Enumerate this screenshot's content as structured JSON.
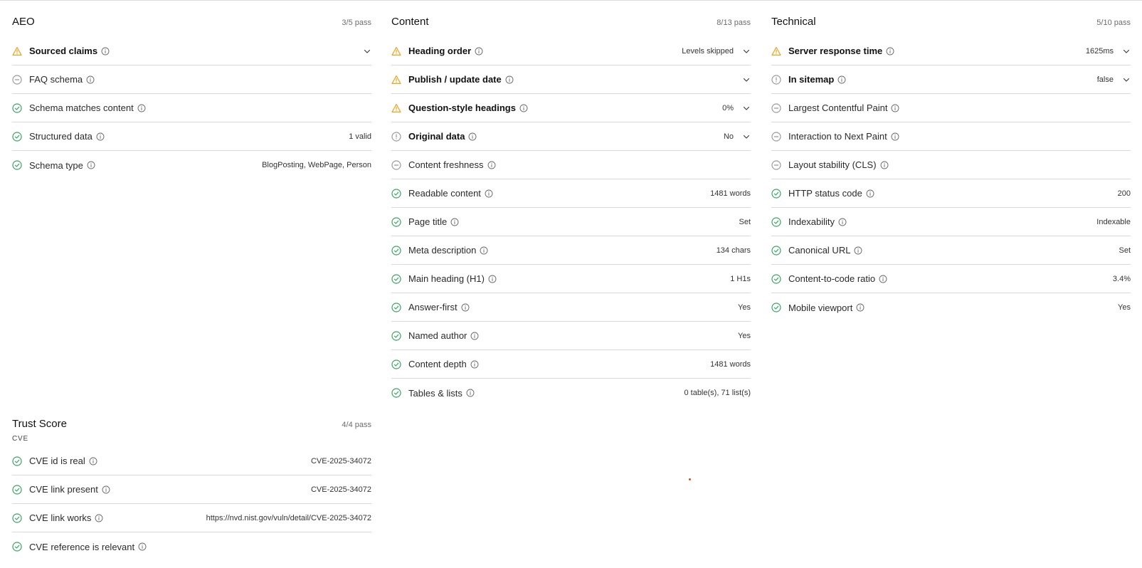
{
  "colors": {
    "pass": "#3aa463",
    "warn": "#e8a423",
    "neutral": "#9a9a9a",
    "divider": "#d9d9d9"
  },
  "icons": {
    "pass": "check-circle-icon",
    "warn": "warning-triangle-icon",
    "skip": "minus-circle-icon",
    "alert": "exclamation-circle-icon",
    "info": "info-icon",
    "expand": "chevron-down-icon"
  },
  "aeo": {
    "title": "AEO",
    "count": "3/5 pass",
    "rows": [
      {
        "label": "Sourced claims",
        "value": "",
        "status": "warn",
        "expandable": true
      },
      {
        "label": "FAQ schema",
        "value": "",
        "status": "skip",
        "expandable": false
      },
      {
        "label": "Schema matches content",
        "value": "",
        "status": "pass",
        "expandable": false
      },
      {
        "label": "Structured data",
        "value": "1 valid",
        "status": "pass",
        "expandable": false
      },
      {
        "label": "Schema type",
        "value": "BlogPosting, WebPage, Person",
        "status": "pass",
        "expandable": false
      }
    ]
  },
  "content": {
    "title": "Content",
    "count": "8/13 pass",
    "rows": [
      {
        "label": "Heading order",
        "value": "Levels skipped",
        "status": "warn",
        "expandable": true
      },
      {
        "label": "Publish / update date",
        "value": "",
        "status": "warn",
        "expandable": true
      },
      {
        "label": "Question-style headings",
        "value": "0%",
        "status": "warn",
        "expandable": true
      },
      {
        "label": "Original data",
        "value": "No",
        "status": "alert",
        "expandable": true
      },
      {
        "label": "Content freshness",
        "value": "",
        "status": "skip",
        "expandable": false
      },
      {
        "label": "Readable content",
        "value": "1481 words",
        "status": "pass",
        "expandable": false
      },
      {
        "label": "Page title",
        "value": "Set",
        "status": "pass",
        "expandable": false
      },
      {
        "label": "Meta description",
        "value": "134 chars",
        "status": "pass",
        "expandable": false
      },
      {
        "label": "Main heading (H1)",
        "value": "1 H1s",
        "status": "pass",
        "expandable": false
      },
      {
        "label": "Answer-first",
        "value": "Yes",
        "status": "pass",
        "expandable": false
      },
      {
        "label": "Named author",
        "value": "Yes",
        "status": "pass",
        "expandable": false
      },
      {
        "label": "Content depth",
        "value": "1481 words",
        "status": "pass",
        "expandable": false
      },
      {
        "label": "Tables & lists",
        "value": "0 table(s), 71 list(s)",
        "status": "pass",
        "expandable": false
      }
    ]
  },
  "technical": {
    "title": "Technical",
    "count": "5/10 pass",
    "rows": [
      {
        "label": "Server response time",
        "value": "1625ms",
        "status": "warn",
        "expandable": true
      },
      {
        "label": "In sitemap",
        "value": "false",
        "status": "alert",
        "expandable": true
      },
      {
        "label": "Largest Contentful Paint",
        "value": "",
        "status": "skip",
        "expandable": false
      },
      {
        "label": "Interaction to Next Paint",
        "value": "",
        "status": "skip",
        "expandable": false
      },
      {
        "label": "Layout stability (CLS)",
        "value": "",
        "status": "skip",
        "expandable": false
      },
      {
        "label": "HTTP status code",
        "value": "200",
        "status": "pass",
        "expandable": false
      },
      {
        "label": "Indexability",
        "value": "Indexable",
        "status": "pass",
        "expandable": false
      },
      {
        "label": "Canonical URL",
        "value": "Set",
        "status": "pass",
        "expandable": false
      },
      {
        "label": "Content-to-code ratio",
        "value": "3.4%",
        "status": "pass",
        "expandable": false
      },
      {
        "label": "Mobile viewport",
        "value": "Yes",
        "status": "pass",
        "expandable": false
      }
    ]
  },
  "trust": {
    "title": "Trust Score",
    "count": "4/4 pass",
    "subtitle": "CVE",
    "rows": [
      {
        "label": "CVE id is real",
        "value": "CVE-2025-34072",
        "status": "pass",
        "expandable": false
      },
      {
        "label": "CVE link present",
        "value": "CVE-2025-34072",
        "status": "pass",
        "expandable": false
      },
      {
        "label": "CVE link works",
        "value": "https://nvd.nist.gov/vuln/detail/CVE-2025-34072",
        "status": "pass",
        "expandable": false
      },
      {
        "label": "CVE reference is relevant",
        "value": "",
        "status": "pass",
        "expandable": false
      }
    ]
  }
}
